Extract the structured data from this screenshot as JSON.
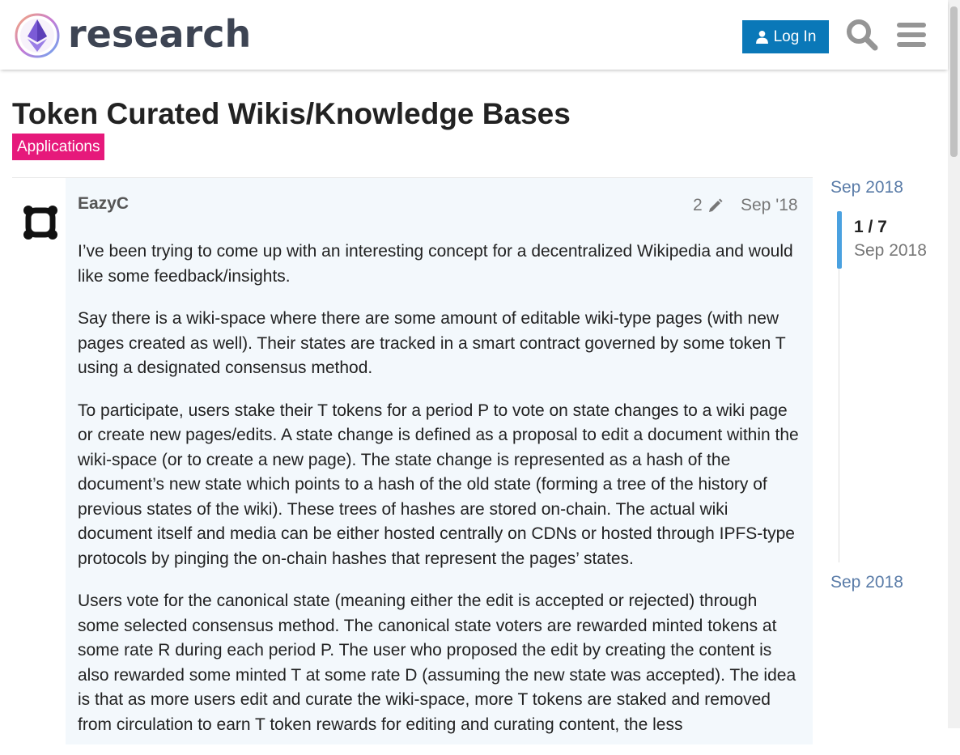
{
  "header": {
    "logo_text": "research",
    "login_label": "Log In"
  },
  "topic": {
    "title": "Token Curated Wikis/Knowledge Bases",
    "category": "Applications",
    "category_color": "#e6197b"
  },
  "post": {
    "username": "EazyC",
    "edit_count": "2",
    "date": "Sep '18",
    "paragraphs": [
      "I’ve been trying to come up with an interesting concept for a decentralized Wikipedia and would like some feedback/insights.",
      "Say there is a wiki-space where there are some amount of editable wiki-type pages (with new pages created as well). Their states are tracked in a smart contract governed by some token T using a designated consensus method.",
      "To participate, users stake their T tokens for a period P to vote on state changes to a wiki page or create new pages/edits. A state change is defined as a proposal to edit a document within the wiki-space (or to create a new page). The state change is represented as a hash of the document’s new state which points to a hash of the old state (forming a tree of the history of previous states of the wiki). These trees of hashes are stored on-chain. The actual wiki document itself and media can be either hosted centrally on CDNs or hosted through IPFS-type protocols by pinging the on-chain hashes that represent the pages’ states.",
      "Users vote for the canonical state (meaning either the edit is accepted or rejected) through some selected consensus method. The canonical state voters are rewarded minted tokens at some rate R during each period P. The user who proposed the edit by creating the content is also rewarded some minted T at some rate D (assuming the new state was accepted). The idea is that as more users edit and curate the wiki-space, more T tokens are staked and removed from circulation to earn T token rewards for editing and curating content, the less"
    ]
  },
  "timeline": {
    "start_date": "Sep 2018",
    "position": "1 / 7",
    "position_date": "Sep 2018",
    "end_date": "Sep 2018"
  },
  "colors": {
    "login_button": "#0a78b8",
    "post_background": "#f3f8fc",
    "timeline_handle": "#4aa1e0",
    "timeline_link": "#5a7ca8"
  },
  "icons": [
    "research-logo-icon",
    "user-icon",
    "search-icon",
    "hamburger-menu-icon",
    "pencil-icon",
    "avatar-icon"
  ]
}
